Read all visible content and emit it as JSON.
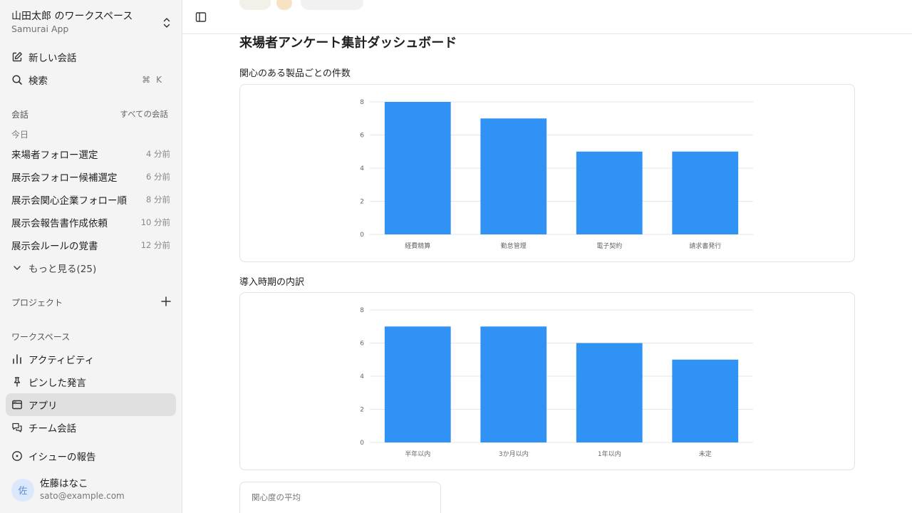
{
  "workspace": {
    "title": "山田太郎 のワークスペース",
    "subtitle": "Samurai App"
  },
  "nav_top": {
    "new_chat": "新しい会話",
    "search": "検索",
    "search_shortcut": "⌘K"
  },
  "conversations": {
    "label": "会話",
    "all_link": "すべての会話",
    "today": "今日",
    "items": [
      {
        "title": "来場者フォロー選定",
        "time": "4 分前"
      },
      {
        "title": "展示会フォロー候補選定",
        "time": "6 分前"
      },
      {
        "title": "展示会関心企業フォロー順",
        "time": "8 分前"
      },
      {
        "title": "展示会報告書作成依頼",
        "time": "10 分前"
      },
      {
        "title": "展示会ルールの覚書",
        "time": "12 分前"
      }
    ],
    "more": "もっと見る(25)"
  },
  "projects": {
    "label": "プロジェクト"
  },
  "workspace_section": {
    "label": "ワークスペース",
    "items": [
      {
        "label": "アクティビティ",
        "icon": "bar-chart-icon"
      },
      {
        "label": "ピンした発言",
        "icon": "pin-icon"
      },
      {
        "label": "アプリ",
        "icon": "app-window-icon",
        "active": true
      },
      {
        "label": "チーム会話",
        "icon": "chat-bubbles-icon"
      }
    ]
  },
  "report_issue": "イシューの報告",
  "user": {
    "avatar": "佐",
    "name": "佐藤はなこ",
    "email": "sato@example.com"
  },
  "main": {
    "title": "来場者アンケート集計ダッシュボード",
    "stat": {
      "label": "関心度の平均"
    }
  },
  "colors": {
    "bar": "#3092f5",
    "sidebar_bg": "#f4f4f4",
    "active_item": "#e0e0e0"
  },
  "chart_data": [
    {
      "type": "bar",
      "title": "関心のある製品ごとの件数",
      "categories": [
        "経費精算",
        "勤怠管理",
        "電子契約",
        "請求書発行"
      ],
      "values": [
        8,
        7,
        5,
        5
      ],
      "ylim": [
        0,
        8
      ],
      "yticks": [
        0,
        2,
        4,
        6,
        8
      ],
      "grid": true
    },
    {
      "type": "bar",
      "title": "導入時期の内訳",
      "categories": [
        "半年以内",
        "3か月以内",
        "1年以内",
        "未定"
      ],
      "values": [
        7,
        7,
        6,
        5
      ],
      "ylim": [
        0,
        8
      ],
      "yticks": [
        0,
        2,
        4,
        6,
        8
      ],
      "grid": true
    }
  ]
}
